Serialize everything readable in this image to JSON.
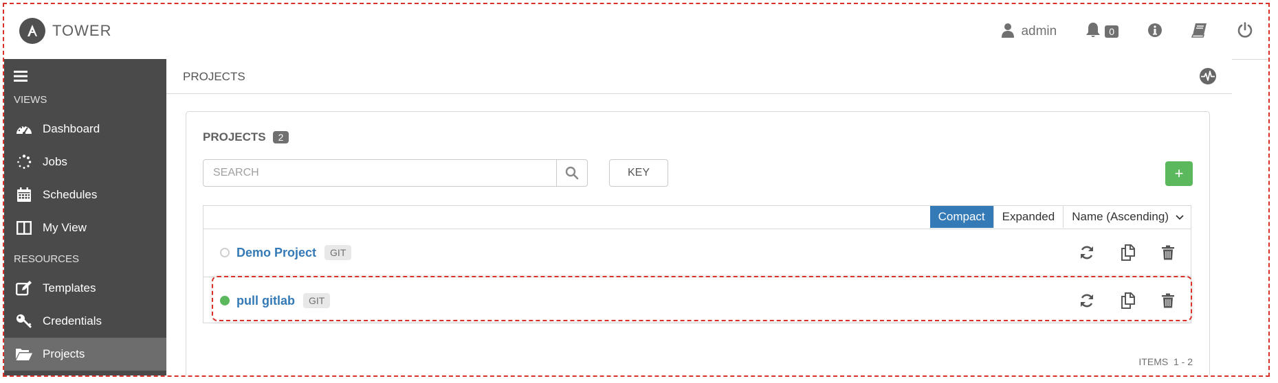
{
  "brand": {
    "name": "TOWER"
  },
  "topbar": {
    "user": "admin",
    "notifications_count": "0",
    "icons": [
      "user-icon",
      "bell-icon",
      "info-icon",
      "book-icon",
      "power-icon"
    ]
  },
  "sidebar": {
    "views_label": "VIEWS",
    "resources_label": "RESOURCES",
    "items": [
      {
        "label": "Dashboard",
        "icon": "dashboard-icon"
      },
      {
        "label": "Jobs",
        "icon": "spinner-icon"
      },
      {
        "label": "Schedules",
        "icon": "calendar-icon"
      },
      {
        "label": "My View",
        "icon": "columns-icon"
      },
      {
        "label": "Templates",
        "icon": "edit-icon"
      },
      {
        "label": "Credentials",
        "icon": "key-icon"
      },
      {
        "label": "Projects",
        "icon": "folder-open-icon"
      }
    ],
    "active": "Projects"
  },
  "subheader": {
    "title": "PROJECTS"
  },
  "panel": {
    "title": "PROJECTS",
    "count": "2",
    "search_placeholder": "SEARCH",
    "key_label": "KEY",
    "add_label": "+",
    "view_modes": [
      "Compact",
      "Expanded"
    ],
    "active_view": "Compact",
    "sort_label": "Name (Ascending)",
    "items_label": "ITEMS  1 - 2"
  },
  "projects": [
    {
      "name": "Demo Project",
      "scm": "GIT",
      "status": "idle"
    },
    {
      "name": "pull gitlab",
      "scm": "GIT",
      "status": "successful"
    }
  ],
  "colors": {
    "sidebar_bg": "#4a4a4a",
    "sidebar_active": "#6d6d6d",
    "link": "#337ab7",
    "add_button": "#5cb85c",
    "status_ok": "#5cb85c",
    "highlight_border": "#d9302a"
  }
}
